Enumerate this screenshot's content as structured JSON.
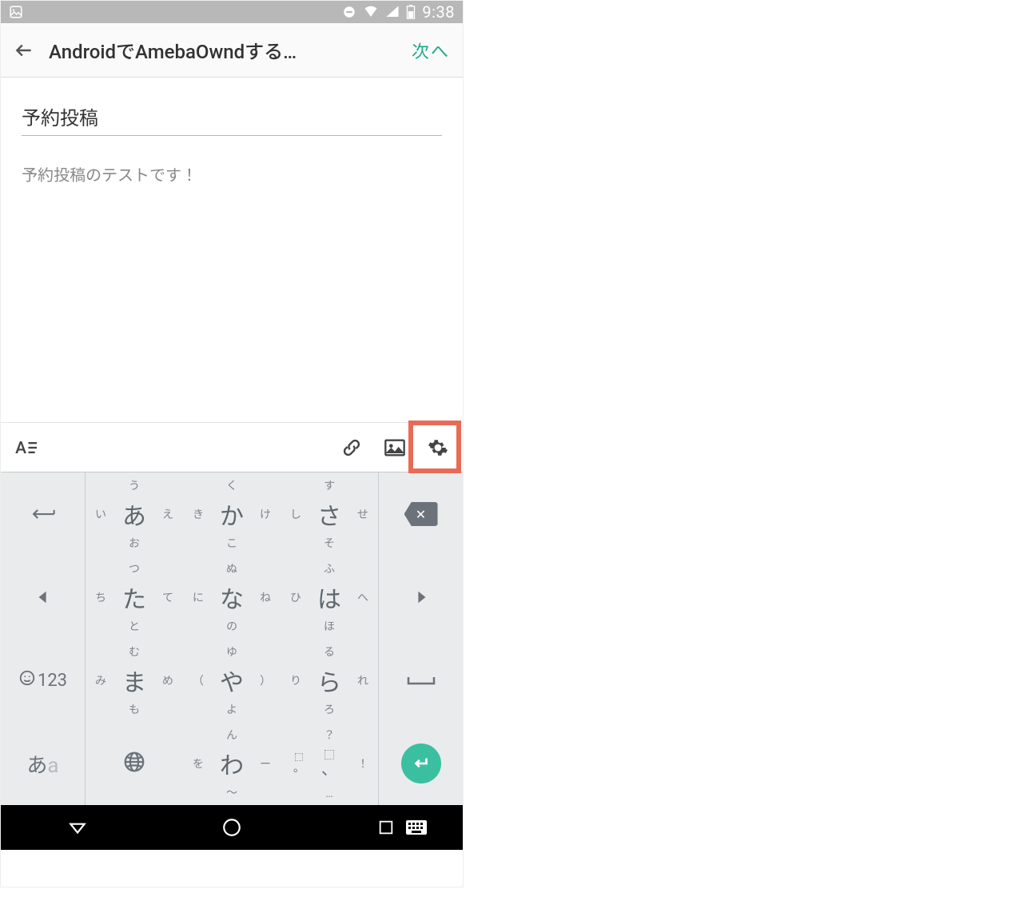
{
  "status": {
    "time": "9:38"
  },
  "header": {
    "title": "AndroidでAmebaOwndする…",
    "next_label": "次へ"
  },
  "editor": {
    "title_value": "予約投稿",
    "body_value": "予約投稿のテストです！"
  },
  "toolbar": {
    "format": "A≡",
    "link_icon": "link",
    "image_icon": "image",
    "settings_icon": "gear"
  },
  "keyboard": {
    "rows": [
      [
        {
          "type": "icon",
          "name": "undo-icon",
          "icon": "undo"
        },
        {
          "main": "あ",
          "top": "う",
          "bottom": "お",
          "left": "い",
          "right": "え"
        },
        {
          "main": "か",
          "top": "く",
          "bottom": "こ",
          "left": "き",
          "right": "け"
        },
        {
          "main": "さ",
          "top": "す",
          "bottom": "そ",
          "left": "し",
          "right": "せ"
        },
        {
          "type": "icon",
          "name": "backspace-icon",
          "icon": "backspace"
        }
      ],
      [
        {
          "type": "icon",
          "name": "left-arrow-icon",
          "icon": "left"
        },
        {
          "main": "た",
          "top": "つ",
          "bottom": "と",
          "left": "ち",
          "right": "て"
        },
        {
          "main": "な",
          "top": "ぬ",
          "bottom": "の",
          "left": "に",
          "right": "ね"
        },
        {
          "main": "は",
          "top": "ふ",
          "bottom": "ほ",
          "left": "ひ",
          "right": "へ"
        },
        {
          "type": "icon",
          "name": "right-arrow-icon",
          "icon": "right"
        }
      ],
      [
        {
          "type": "mode123",
          "emoji": "☺",
          "digits": "123"
        },
        {
          "main": "ま",
          "top": "む",
          "bottom": "も",
          "left": "み",
          "right": "め"
        },
        {
          "main": "や",
          "top": "ゆ",
          "bottom": "よ",
          "left": "（",
          "right": "）"
        },
        {
          "main": "ら",
          "top": "る",
          "bottom": "ろ",
          "left": "り",
          "right": "れ"
        },
        {
          "type": "icon",
          "name": "space-icon",
          "icon": "space"
        }
      ],
      [
        {
          "type": "kana-mode",
          "hira": "あ",
          "lat": "a"
        },
        {
          "type": "icon",
          "name": "globe-icon",
          "icon": "globe"
        },
        {
          "main": "わ",
          "top": "ん",
          "bottom": "〜",
          "left": "を",
          "right": "ー"
        },
        {
          "type": "punct",
          "top": "？",
          "mid_l": "。",
          "mid_r": "、",
          "right": "！",
          "bottom": "…"
        },
        {
          "type": "enter"
        }
      ]
    ]
  }
}
